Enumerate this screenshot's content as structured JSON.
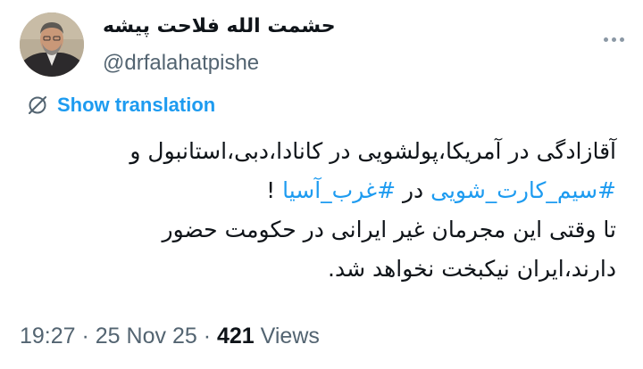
{
  "author": {
    "display_name": "حشمت الله فلاحت پیشه",
    "handle": "@drfalahatpishe"
  },
  "translation": {
    "label": "Show translation"
  },
  "tweet": {
    "line1": "آقازادگی در آمریکا،پولشویی در کانادا،دبی،استانبول و",
    "hashtag1": "#سیم_کارت_شویی",
    "connector": " در ",
    "hashtag2": "#غرب_آسیا",
    "exclaim": " !",
    "line3": "تا وقتی این مجرمان غیر ایرانی در حکومت حضور",
    "line4": "دارند،ایران نیکبخت نخواهد شد."
  },
  "meta": {
    "time": "19:27",
    "sep1": " · ",
    "date": "25 Nov 25",
    "sep2": " · ",
    "views_count": "421",
    "views_label": " Views"
  },
  "colors": {
    "link": "#1d9bf0",
    "secondary_text": "#536471",
    "primary_text": "#0f1419"
  },
  "icons": {
    "more": "more-dots-icon",
    "translation": "translate-slash-icon"
  }
}
